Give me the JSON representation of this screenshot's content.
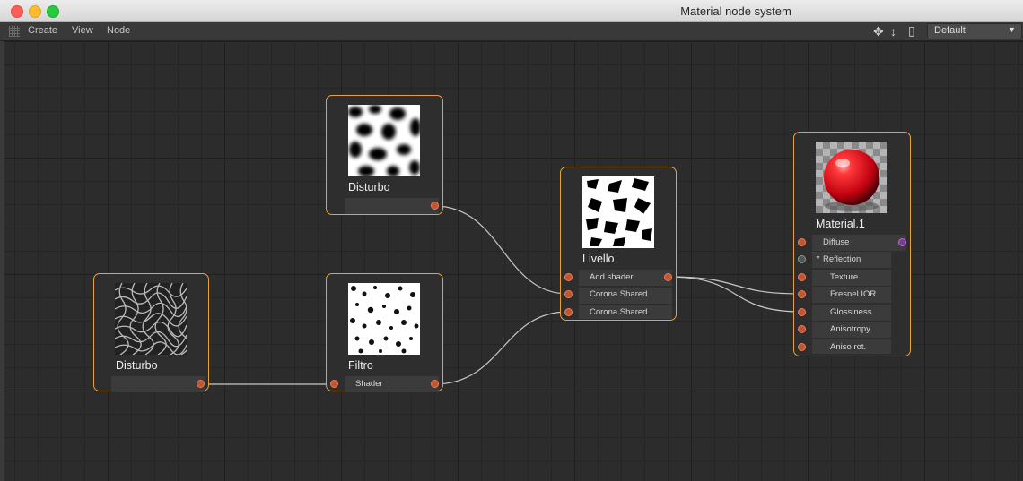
{
  "window": {
    "title": "Material node system"
  },
  "menubar": {
    "items": [
      "Create",
      "View",
      "Node"
    ],
    "preset": "Default"
  },
  "nodes": {
    "disturbo_top": {
      "name": "Disturbo"
    },
    "disturbo_left": {
      "name": "Disturbo"
    },
    "filtro": {
      "name": "Filtro",
      "port": "Shader"
    },
    "livello": {
      "name": "Livello",
      "ports": [
        "Add shader",
        "Corona Shared",
        "Corona Shared"
      ]
    },
    "material": {
      "name": "Material.1",
      "ports": [
        "Diffuse",
        "Reflection",
        "Texture",
        "Fresnel IOR",
        "Glossiness",
        "Anisotropy",
        "Aniso rot."
      ]
    }
  },
  "colors": {
    "accent": "#e8a23a",
    "port": "#c4542e",
    "wire": "#c8c8c8"
  }
}
